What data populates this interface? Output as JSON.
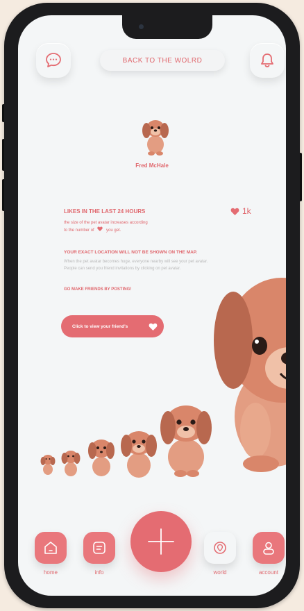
{
  "header": {
    "back_label": "BACK TO THE WOLRD"
  },
  "profile": {
    "name": "Fred McHale"
  },
  "likes": {
    "title": "LIKES IN THE LAST 24 HOURS",
    "subtitle_1": "the size of the pet avatar increases according",
    "subtitle_2": "to the number of",
    "subtitle_3": "you get.",
    "count": "1k"
  },
  "info": {
    "warning": "YOUR EXACT LOCATION WILL NOT BE SHOWN ON THE MAP.",
    "description": "When the pet avatar becomes huge, everyone nearby will see your pet avatar. People can send you friend invitations by clicking on pet avatar.",
    "cta_text": "GO MAKE FRIENDS BY POSTING!"
  },
  "friends_button": {
    "label": "Click to view your friend's"
  },
  "nav": {
    "home": "home",
    "info": "info",
    "world": "world",
    "account": "account"
  },
  "colors": {
    "accent": "#e46c72",
    "background": "#f4f6f7",
    "frame": "#1c1c1e"
  },
  "icons": [
    "chat-icon",
    "bell-icon",
    "heart-icon",
    "home-icon",
    "info-icon",
    "plus-icon",
    "location-icon",
    "user-icon"
  ]
}
